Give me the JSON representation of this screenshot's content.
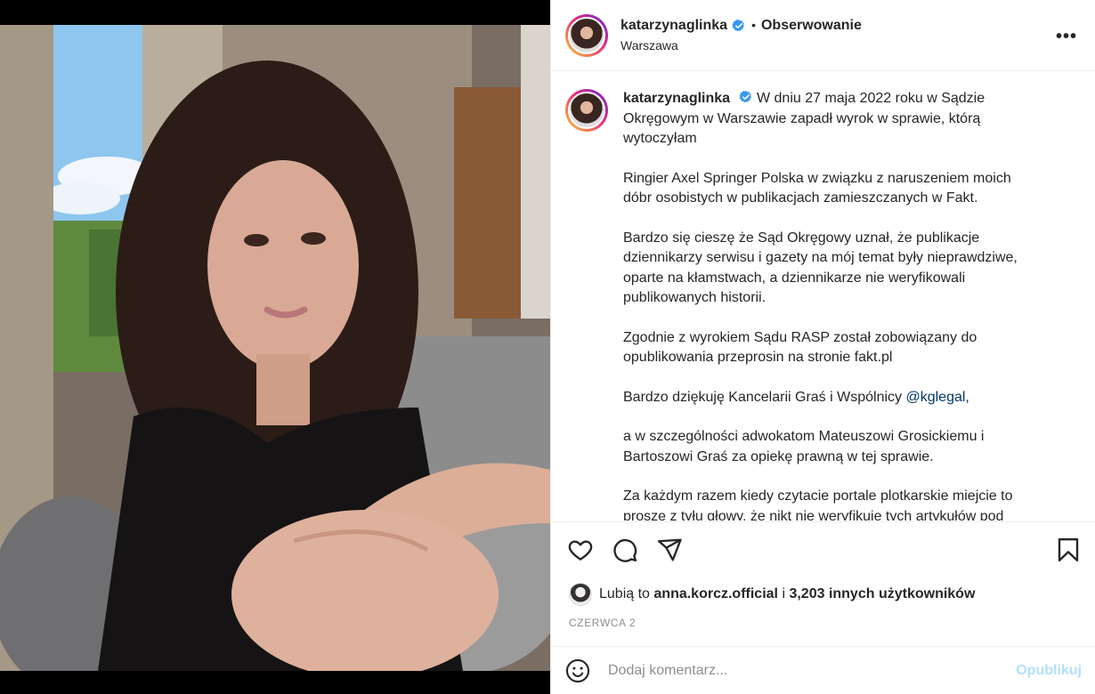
{
  "post": {
    "username": "katarzynaglinka",
    "follow_label": "Obserwowanie",
    "dot": "•",
    "location": "Warszawa",
    "more_label": "•••"
  },
  "caption": {
    "username": "katarzynaglinka",
    "paragraphs": [
      "W dniu 27 maja 2022 roku w Sądzie Okręgowym w Warszawie zapadł wyrok w sprawie, którą wytoczyłam",
      "Ringier Axel Springer Polska w związku z naruszeniem moich dóbr osobistych w publikacjach zamieszczanych w Fakt.",
      "Bardzo się cieszę że Sąd Okręgowy uznał, że publikacje dziennikarzy serwisu i gazety na mój temat były nieprawdziwe, oparte na kłamstwach, a dziennikarze nie weryfikowali publikowanych historii.",
      "Zgodnie z wyrokiem Sądu RASP został zobowiązany do opublikowania przeprosin na stronie fakt.pl",
      "Bardzo dziękuję Kancelarii Graś i Wspólnicy",
      "a w szczególności adwokatom Mateuszowi Grosickiemu i Bartoszowi Graś za opiekę prawną w tej sprawie.",
      "Za każdym razem kiedy czytacie portale plotkarskie miejcie to proszę z tyłu głowy, że nikt nie weryfikuje tych artykułów pod"
    ],
    "mention": "@kglegal",
    "mention_suffix": ","
  },
  "likes": {
    "prefix": "Lubią to",
    "user": "anna.korcz.official",
    "joiner": "i",
    "others": "3,203 innych użytkowników"
  },
  "date": "CZERWCA 2",
  "comment": {
    "placeholder": "Dodaj komentarz...",
    "publish_label": "Opublikuj"
  },
  "icons": {
    "like": "heart-icon",
    "comment": "comment-icon",
    "share": "share-icon",
    "save": "bookmark-icon",
    "emoji": "emoji-icon",
    "verified": "verified-badge-icon",
    "more": "more-options-icon"
  },
  "colors": {
    "verified": "#3897f0",
    "mention": "#00376b",
    "publish_disabled": "#b2dffc",
    "muted": "#8e8e8e"
  }
}
